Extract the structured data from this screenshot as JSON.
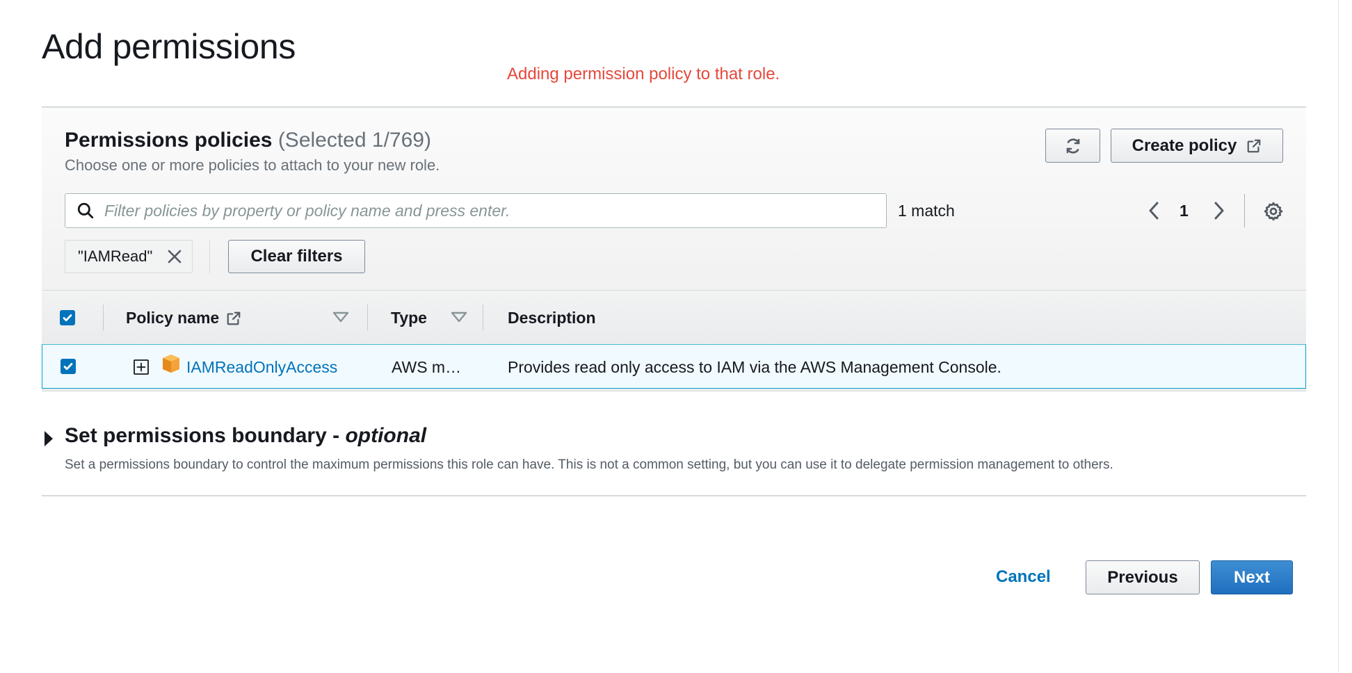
{
  "page": {
    "title": "Add permissions",
    "annotation": "Adding permission policy to that role."
  },
  "permissions_panel": {
    "title": "Permissions policies",
    "selected_count": "(Selected 1/769)",
    "description": "Choose one or more policies to attach to your new role.",
    "refresh_icon": "refresh-icon",
    "create_policy_label": "Create policy",
    "create_policy_icon": "external-link-icon"
  },
  "search": {
    "placeholder": "Filter policies by property or policy name and press enter.",
    "value": "",
    "match_text": "1 match"
  },
  "pagination": {
    "current_page": "1"
  },
  "filters": {
    "token": "\"IAMRead\"",
    "clear_label": "Clear filters"
  },
  "table": {
    "columns": [
      "Policy name",
      "Type",
      "Description"
    ],
    "header_checked": true,
    "rows": [
      {
        "checked": true,
        "name": "IAMReadOnlyAccess",
        "type": "AWS m…",
        "description": "Provides read only access to IAM via the AWS Management Console."
      }
    ]
  },
  "boundary": {
    "title": "Set permissions boundary -",
    "title_optional": "optional",
    "description": "Set a permissions boundary to control the maximum permissions this role can have. This is not a common setting, but you can use it to delegate permission management to others."
  },
  "footer": {
    "cancel_label": "Cancel",
    "previous_label": "Previous",
    "next_label": "Next"
  },
  "colors": {
    "accent": "#0073bb",
    "annotation": "#e5483b",
    "primary_button": "#1f6fbf",
    "selected_row_bg": "#f1faff",
    "selected_row_border": "#00a1c9"
  }
}
